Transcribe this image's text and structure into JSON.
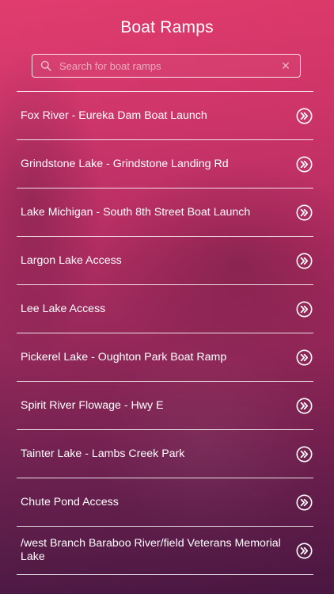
{
  "header": {
    "title": "Boat Ramps"
  },
  "search": {
    "placeholder": "Search for boat ramps",
    "value": "",
    "icon": "search-icon",
    "clear_icon": "close-icon",
    "clear_glyph": "✕"
  },
  "ramps": [
    {
      "label": "Fox River - Eureka Dam Boat Launch"
    },
    {
      "label": "Grindstone Lake - Grindstone Landing Rd"
    },
    {
      "label": "Lake Michigan - South 8th Street Boat Launch"
    },
    {
      "label": "Largon Lake Access"
    },
    {
      "label": "Lee Lake Access"
    },
    {
      "label": "Pickerel Lake - Oughton Park Boat Ramp"
    },
    {
      "label": "Spirit River Flowage - Hwy E"
    },
    {
      "label": "Tainter Lake - Lambs Creek Park"
    },
    {
      "label": "Chute Pond Access"
    },
    {
      "label": "/west Branch Baraboo River/field Veterans Memorial Lake"
    }
  ],
  "colors": {
    "gradient_top": "#e0366a",
    "gradient_bottom": "#4e1845",
    "text": "#ffffff"
  }
}
